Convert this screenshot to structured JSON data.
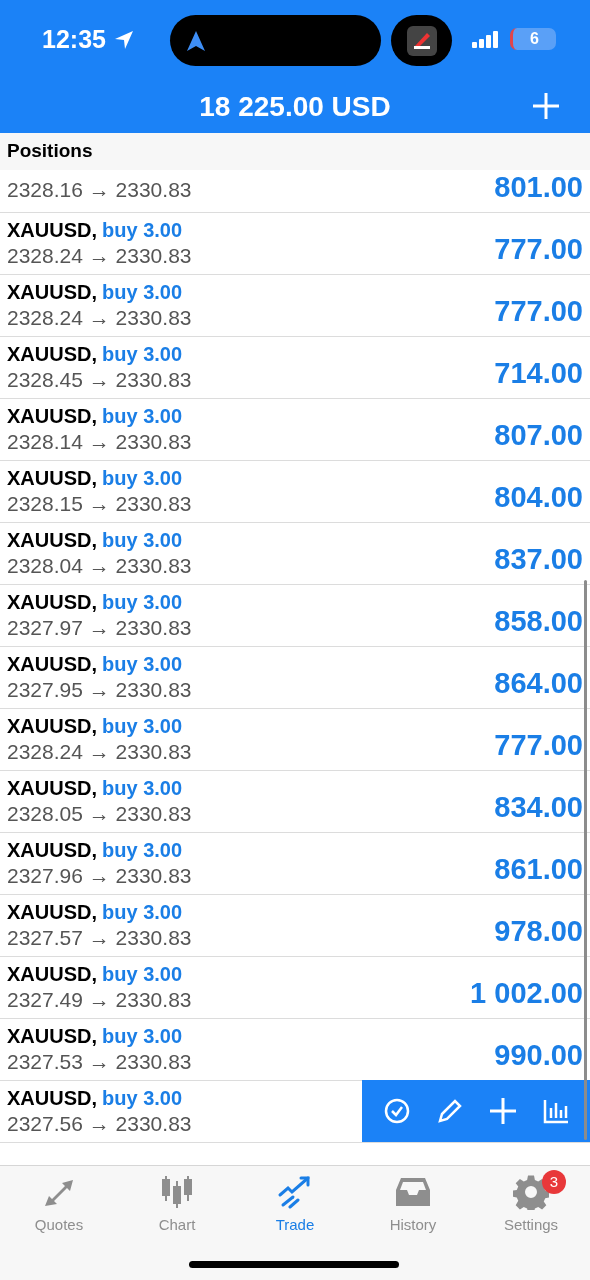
{
  "status_bar": {
    "time": "12:35",
    "battery": "6"
  },
  "header": {
    "balance": "18 225.00 USD"
  },
  "section": {
    "title": "Positions"
  },
  "positions": [
    {
      "price": "2328.16 → 2330.83",
      "profit": "801.00"
    },
    {
      "symbol": "XAUUSD,",
      "side": "buy 3.00",
      "price": "2328.24 → 2330.83",
      "profit": "777.00"
    },
    {
      "symbol": "XAUUSD,",
      "side": "buy 3.00",
      "price": "2328.24 → 2330.83",
      "profit": "777.00"
    },
    {
      "symbol": "XAUUSD,",
      "side": "buy 3.00",
      "price": "2328.45 → 2330.83",
      "profit": "714.00"
    },
    {
      "symbol": "XAUUSD,",
      "side": "buy 3.00",
      "price": "2328.14 → 2330.83",
      "profit": "807.00"
    },
    {
      "symbol": "XAUUSD,",
      "side": "buy 3.00",
      "price": "2328.15 → 2330.83",
      "profit": "804.00"
    },
    {
      "symbol": "XAUUSD,",
      "side": "buy 3.00",
      "price": "2328.04 → 2330.83",
      "profit": "837.00"
    },
    {
      "symbol": "XAUUSD,",
      "side": "buy 3.00",
      "price": "2327.97 → 2330.83",
      "profit": "858.00"
    },
    {
      "symbol": "XAUUSD,",
      "side": "buy 3.00",
      "price": "2327.95 → 2330.83",
      "profit": "864.00"
    },
    {
      "symbol": "XAUUSD,",
      "side": "buy 3.00",
      "price": "2328.24 → 2330.83",
      "profit": "777.00"
    },
    {
      "symbol": "XAUUSD,",
      "side": "buy 3.00",
      "price": "2328.05 → 2330.83",
      "profit": "834.00"
    },
    {
      "symbol": "XAUUSD,",
      "side": "buy 3.00",
      "price": "2327.96 → 2330.83",
      "profit": "861.00"
    },
    {
      "symbol": "XAUUSD,",
      "side": "buy 3.00",
      "price": "2327.57 → 2330.83",
      "profit": "978.00"
    },
    {
      "symbol": "XAUUSD,",
      "side": "buy 3.00",
      "price": "2327.49 → 2330.83",
      "profit": "1 002.00"
    },
    {
      "symbol": "XAUUSD,",
      "side": "buy 3.00",
      "price": "2327.53 → 2330.83",
      "profit": "990.00"
    },
    {
      "symbol": "XAUUSD,",
      "side": "buy 3.00",
      "price": "2327.56 → 2330.83",
      "actions": true
    }
  ],
  "tabs": [
    {
      "label": "Quotes",
      "kind": "quotes",
      "selected": false
    },
    {
      "label": "Chart",
      "kind": "chart",
      "selected": false
    },
    {
      "label": "Trade",
      "kind": "trade",
      "selected": true
    },
    {
      "label": "History",
      "kind": "history",
      "selected": false
    },
    {
      "label": "Settings",
      "kind": "settings",
      "selected": false,
      "badge": "3"
    }
  ]
}
